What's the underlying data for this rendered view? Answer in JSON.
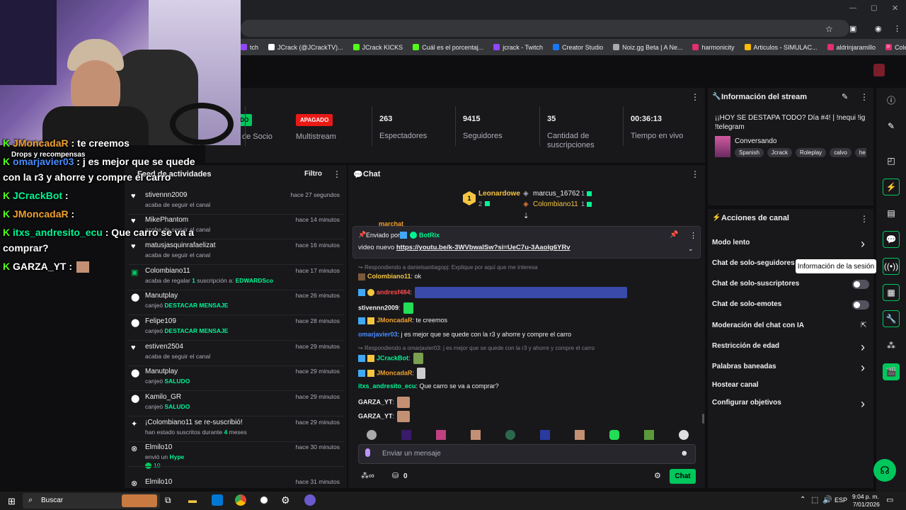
{
  "bookmarks": [
    {
      "label": "tch",
      "color": "#9146ff"
    },
    {
      "label": "JCrack (@JCrackTV)...",
      "color": "#ffffff"
    },
    {
      "label": "JCrack KICKS",
      "color": "#53fc18"
    },
    {
      "label": "Cuál es el porcentaj...",
      "color": "#53fc18"
    },
    {
      "label": "jcrack - Twitch",
      "color": "#9146ff"
    },
    {
      "label": "Creator Studio",
      "color": "#1877f2"
    },
    {
      "label": "Noiz.gg Beta | A Ne...",
      "color": "#aaaaaa"
    },
    {
      "label": "harmonicity",
      "color": "#e1306c"
    },
    {
      "label": "Articulos - SIMULAC...",
      "color": "#fbbc04"
    },
    {
      "label": "aldrinjaramillo",
      "color": "#e1306c"
    },
    {
      "label": "Colección de M_blei...",
      "color": "#e1306c"
    }
  ],
  "stats": {
    "partner_badge": "IDO",
    "partner_label": "de Socio",
    "multistream_badge": "APAGADO",
    "multistream_label": "Multistream",
    "viewers": "263",
    "viewers_label": "Espectadores",
    "followers": "9415",
    "followers_label": "Seguidores",
    "subs": "35",
    "subs_label": "Cantidad de suscripciones",
    "uptime": "00:36:13",
    "uptime_label": "Tiempo en vivo"
  },
  "activity": {
    "title": "Feed de actividades",
    "filter": "Filtro",
    "items": [
      {
        "name": "stivennn2009",
        "sub": "acaba de seguir el canal",
        "time": "hace 27 segundos",
        "icon": "♥"
      },
      {
        "name": "MikePhantom",
        "sub": "acaba de seguir el canal",
        "time": "hace 14 minutos",
        "icon": "♥"
      },
      {
        "name": "matusjasquinrafaelizat",
        "sub": "acaba de seguir el canal",
        "time": "hace 16 minutos",
        "icon": "♥"
      },
      {
        "name": "Colombiano11",
        "sub_pre": "acaba de regalar ",
        "sub_hl": "1",
        "sub_mid": " suscripción a: ",
        "sub_hl2": "EDWARDSco",
        "time": "hace 17 minutos",
        "icon": "▣"
      },
      {
        "name": "Manutplay",
        "sub_pre": "canjeó ",
        "sub_hl": "DESTACAR MENSAJE",
        "time": "hace 26 minutos",
        "icon": "⬤"
      },
      {
        "name": "Felipe109",
        "sub_pre": "canjeó ",
        "sub_hl": "DESTACAR MENSAJE",
        "time": "hace 28 minutos",
        "icon": "⬤"
      },
      {
        "name": "estiven2504",
        "sub": "acaba de seguir el canal",
        "time": "hace 29 minutos",
        "icon": "♥"
      },
      {
        "name": "Manutplay",
        "sub_pre": "canjeó ",
        "sub_hl": "SALUDO",
        "time": "hace 29 minutos",
        "icon": "⬤"
      },
      {
        "name": "Kamilo_GR",
        "sub_pre": "canjeó ",
        "sub_hl": "SALUDO",
        "time": "hace 29 minutos",
        "icon": "⬤"
      },
      {
        "name": "¡Colombiano11 se re-suscribió!",
        "sub_pre": "han estado suscritos durante ",
        "sub_hl": "4",
        "sub_mid": " meses",
        "time": "hace 29 minutos",
        "icon": "✦"
      },
      {
        "name": "Elmilo10",
        "sub_pre": "envió un ",
        "sub_hl": "Hype",
        "sub_line3": "10",
        "time": "hace 30 minutos",
        "icon": "⊗"
      },
      {
        "name": "Elmilo10",
        "sub": "",
        "time": "hace 31 minutos",
        "icon": "⊗"
      }
    ]
  },
  "chat": {
    "title": "Chat",
    "leaders": [
      {
        "name": "Leonardowe",
        "count": "2"
      },
      {
        "name": "marcus_16762",
        "count": "1"
      },
      {
        "name": "Colombiano11",
        "count": "1"
      }
    ],
    "pinned": {
      "sender_pre": "Enviado por",
      "sender": "BotRix",
      "text": "video nuevo ",
      "link": "https://youtu.be/k-3WVbwalSw?si=UeC7u-3AaoIg6YRv"
    },
    "partial_user": "marchat",
    "messages": [
      {
        "type": "reply",
        "text": "Respondiendo a danielsantiagopj: Explique por aquí que me interesa"
      },
      {
        "user": "Colombiano11",
        "color": "#f5c542",
        "text": ": ok"
      },
      {
        "user": "andresf484",
        "color": "#ff4a4a",
        "text": ":"
      },
      {
        "user": "stivennn2009",
        "color": "#efeff1",
        "text": ":"
      },
      {
        "user": "JMoncadaR",
        "color": "#f0a030",
        "text": ": te creemos"
      },
      {
        "user": "omarjavier03",
        "color": "#4a8cff",
        "text": ": j es mejor que se quede con la r3 y ahorre y compre el carro"
      },
      {
        "type": "reply",
        "text": "Respondiendo a omarjavier03: j es mejor que se quede con la r3 y ahorre y compre el carro"
      },
      {
        "user": "JCrackBot",
        "color": "#00f593",
        "text": ":"
      },
      {
        "user": "JMoncadaR",
        "color": "#f0a030",
        "text": ":"
      },
      {
        "user": "itxs_andresito_ecu",
        "color": "#00f593",
        "text": ": Que carro se va a comprar?"
      },
      {
        "user": "GARZA_YT",
        "color": "#efeff1",
        "text": ":"
      },
      {
        "user": "GARZA_YT",
        "color": "#efeff1",
        "text": ":"
      }
    ],
    "input_placeholder": "Enviar un mensaje",
    "send_label": "Chat",
    "points": "0"
  },
  "stream_info": {
    "title": "Información del stream",
    "stream_title": "¡¡HOY SE DESTAPA TODO? Día #4! | !nequi !ig !telegram",
    "category": "Conversando",
    "tags": [
      "Spanish",
      "Jcrack",
      "Roleplay",
      "calvo",
      "he"
    ]
  },
  "channel_actions": {
    "title": "Acciones de canal",
    "items": [
      {
        "label": "Modo lento",
        "kind": "chevron"
      },
      {
        "label": "Chat de solo-seguidores",
        "kind": "none"
      },
      {
        "label": "Chat de solo-suscriptores",
        "kind": "toggle"
      },
      {
        "label": "Chat de solo-emotes",
        "kind": "toggle"
      },
      {
        "label": "Moderación del chat con IA",
        "kind": "external"
      },
      {
        "label": "Restricción de edad",
        "kind": "chevron"
      },
      {
        "label": "Palabras baneadas",
        "kind": "chevron"
      },
      {
        "label": "Hostear canal",
        "kind": "none"
      },
      {
        "label": "Configurar objetivos",
        "kind": "chevron"
      }
    ],
    "tooltip": "Información de la sesión"
  },
  "overlay": {
    "lines": [
      {
        "user": "JMoncadaR",
        "text": " : te creemos",
        "color": "#f0a030"
      },
      {
        "label": "Drops y recompensas"
      },
      {
        "user": "omarjavier03",
        "text": " : j es mejor que se quede",
        "color": "#4a8cff"
      },
      {
        "cont": "con la r3 y ahorre y compre el carro"
      },
      {
        "user": "JCrackBot",
        "text": " :",
        "color": "#00f593"
      },
      {
        "user": "JMoncadaR",
        "text": " :",
        "color": "#f0a030"
      },
      {
        "user": "itxs_andresito_ecu",
        "text": " : Que carro se va a",
        "color": "#00f593"
      },
      {
        "cont": "comprar?"
      },
      {
        "user": "GARZA_YT",
        "text": " :",
        "color": "#ffffff"
      }
    ]
  },
  "taskbar": {
    "search": "Buscar",
    "lang": "ESP",
    "time": "9:04 p. m.",
    "date": "7/01/2026"
  }
}
